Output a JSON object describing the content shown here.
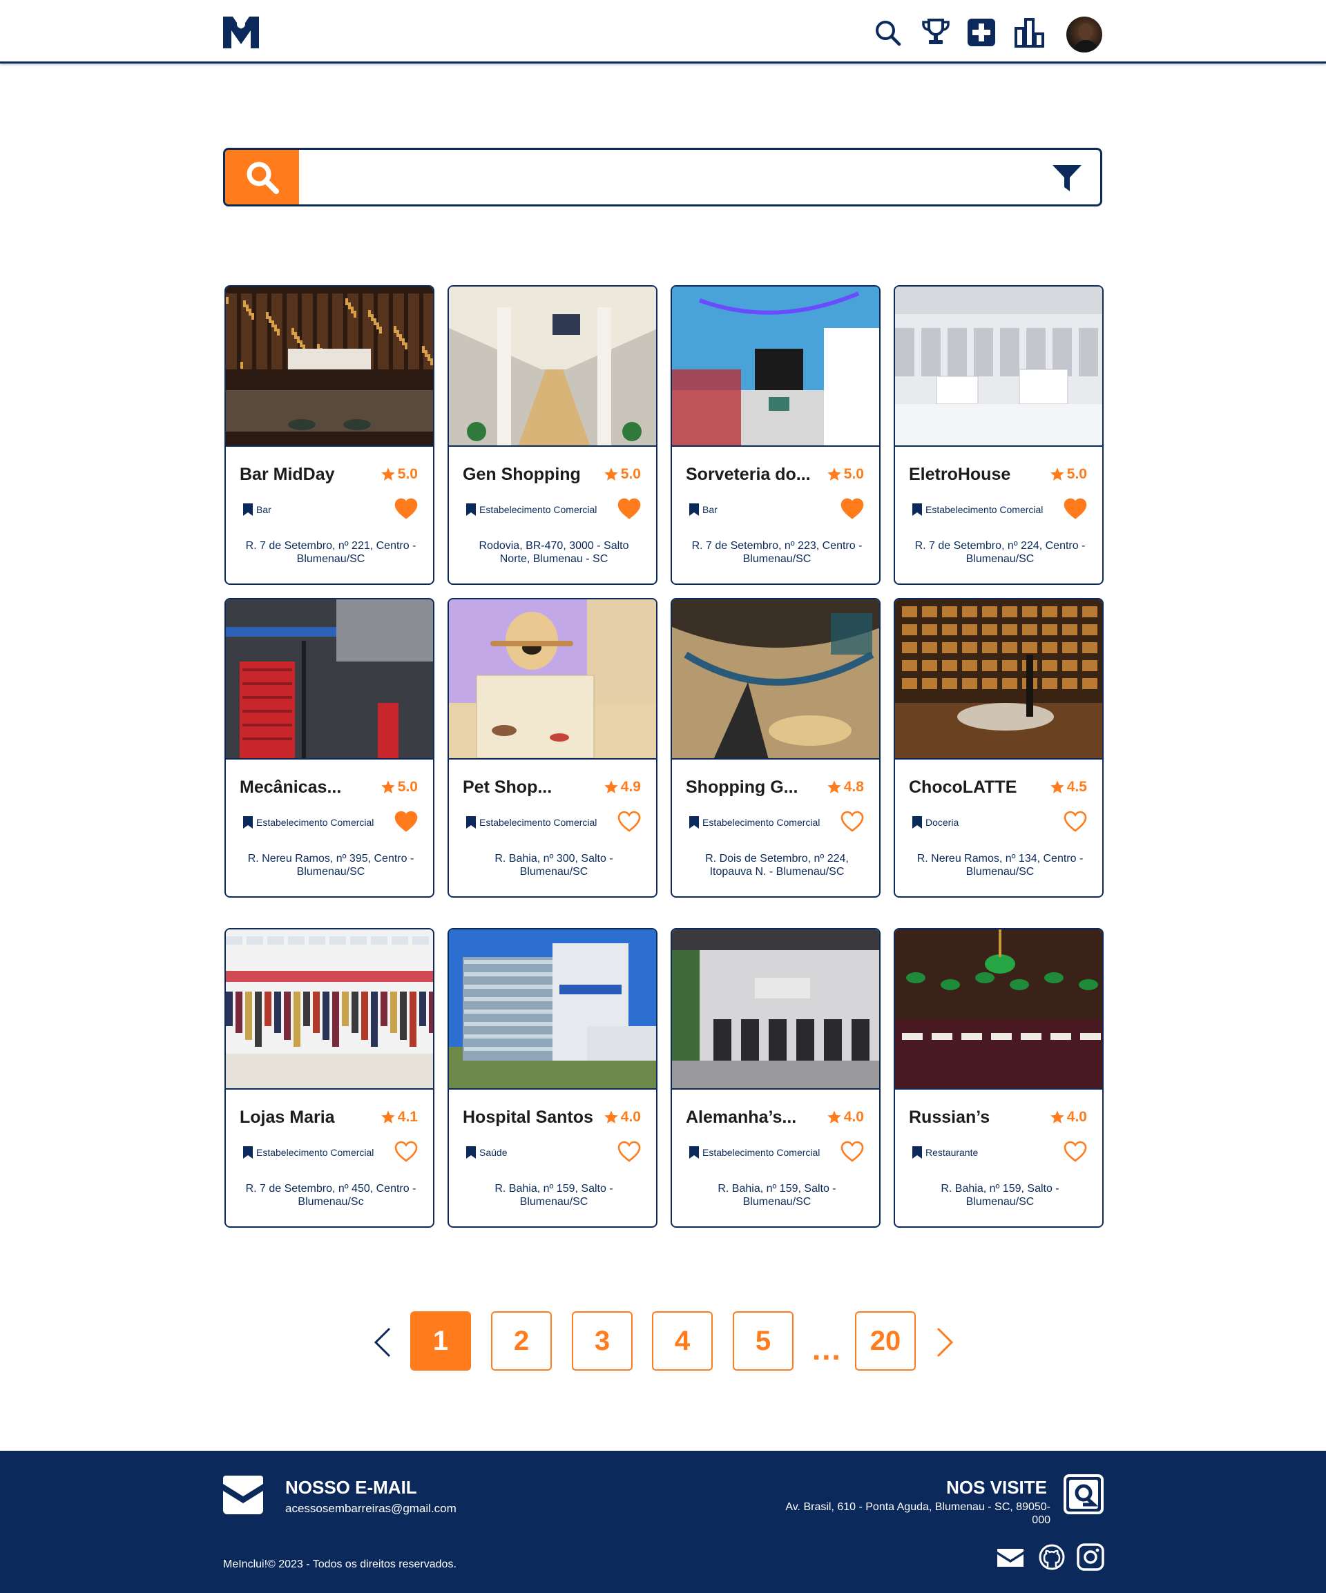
{
  "header": {
    "logo_icon": "meinclui-logo",
    "icons": [
      "search-icon",
      "trophy-icon",
      "plus-square-icon",
      "bar-chart-icon"
    ],
    "avatar": "user-avatar"
  },
  "search": {
    "value": "",
    "placeholder": "",
    "search_icon": "search-icon",
    "filter_icon": "filter-icon"
  },
  "colors": {
    "primary": "#0b2a5b",
    "accent": "#ff7b1c"
  },
  "places": [
    {
      "name": "Bar MidDay",
      "rating": "5.0",
      "category": "Bar",
      "favorite": true,
      "address": "R. 7 de Setembro, nº 221, Centro - Blumenau/SC"
    },
    {
      "name": "Gen Shopping",
      "rating": "5.0",
      "category": "Estabelecimento Comercial",
      "favorite": true,
      "address": "Rodovia, BR-470, 3000 - Salto Norte, Blumenau - SC"
    },
    {
      "name": "Sorveteria do...",
      "rating": "5.0",
      "category": "Bar",
      "favorite": true,
      "address": "R. 7 de Setembro, nº 223, Centro - Blumenau/SC"
    },
    {
      "name": "EletroHouse",
      "rating": "5.0",
      "category": "Estabelecimento Comercial",
      "favorite": true,
      "address": "R. 7 de Setembro, nº 224, Centro - Blumenau/SC"
    },
    {
      "name": "Mecânicas...",
      "rating": "5.0",
      "category": "Estabelecimento Comercial",
      "favorite": true,
      "address": "R. Nereu Ramos, nº 395, Centro - Blumenau/SC"
    },
    {
      "name": "Pet Shop...",
      "rating": "4.9",
      "category": "Estabelecimento Comercial",
      "favorite": false,
      "address": "R. Bahia, nº 300, Salto - Blumenau/SC"
    },
    {
      "name": "Shopping G...",
      "rating": "4.8",
      "category": "Estabelecimento Comercial",
      "favorite": false,
      "address": "R. Dois de Setembro, nº 224, Itopauva N. - Blumenau/SC"
    },
    {
      "name": "ChocoLATTE",
      "rating": "4.5",
      "category": "Doceria",
      "favorite": false,
      "address": "R. Nereu Ramos, nº 134, Centro - Blumenau/SC"
    },
    {
      "name": "Lojas Maria",
      "rating": "4.1",
      "category": "Estabelecimento Comercial",
      "favorite": false,
      "address": "R. 7 de Setembro, nº 450, Centro - Blumenau/Sc"
    },
    {
      "name": "Hospital Santos",
      "rating": "4.0",
      "category": "Saúde",
      "favorite": false,
      "address": "R. Bahia, nº 159, Salto - Blumenau/SC"
    },
    {
      "name": "Alemanha’s...",
      "rating": "4.0",
      "category": "Estabelecimento Comercial",
      "favorite": false,
      "address": "R. Bahia, nº 159, Salto - Blumenau/SC"
    },
    {
      "name": "Russian’s",
      "rating": "4.0",
      "category": "Restaurante",
      "favorite": false,
      "address": "R. Bahia, nº 159, Salto - Blumenau/SC"
    }
  ],
  "pagination": {
    "pages": [
      "1",
      "2",
      "3",
      "4",
      "5"
    ],
    "ellipsis": "...",
    "last": "20",
    "current": "1",
    "prev_icon": "chevron-left-icon",
    "next_icon": "chevron-right-icon"
  },
  "footer": {
    "email_title": "NOSSO E-MAIL",
    "email": "acessosembarreiras@gmail.com",
    "visit_title": "NOS VISITE",
    "address": "Av. Brasil, 610 - Ponta Aguda, Blumenau - SC, 89050-000",
    "copyright": "MeInclui!© 2023 - Todos os direitos reservados.",
    "social_icons": [
      "mail-icon",
      "github-icon",
      "instagram-icon"
    ]
  }
}
